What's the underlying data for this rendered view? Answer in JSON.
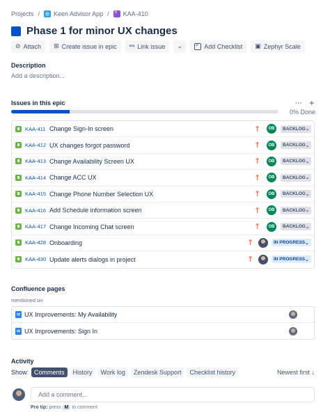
{
  "breadcrumb": {
    "projects": "Projects",
    "project": "Keen Advisor App",
    "issue_key": "KAA-410",
    "sep": "/"
  },
  "issue": {
    "title": "Phase 1 for minor UX changes"
  },
  "toolbar": {
    "attach": "Attach",
    "create_issue": "Create issue in epic",
    "link_issue": "Link issue",
    "add_checklist": "Add Checklist",
    "zephyr": "Zephyr Scale"
  },
  "description": {
    "heading": "Description",
    "placeholder": "Add a description..."
  },
  "epic": {
    "heading": "Issues in this epic",
    "progress_text": "0% Done",
    "progress_fraction": 0.22,
    "issues": [
      {
        "key": "KAA-411",
        "summary": "Change Sign-In screen",
        "assignee": "OB",
        "status": "BACKLOG"
      },
      {
        "key": "KAA-412",
        "summary": "UX changes forgot password",
        "assignee": "OB",
        "status": "BACKLOG"
      },
      {
        "key": "KAA-413",
        "summary": "Change Availability Screen UX",
        "assignee": "OB",
        "status": "BACKLOG"
      },
      {
        "key": "KAA-414",
        "summary": "Change ACC UX",
        "assignee": "OB",
        "status": "BACKLOG"
      },
      {
        "key": "KAA-415",
        "summary": "Change Phone Number Selection UX",
        "assignee": "OB",
        "status": "BACKLOG"
      },
      {
        "key": "KAA-416",
        "summary": "Add Schedule information screen",
        "assignee": "OB",
        "status": "BACKLOG"
      },
      {
        "key": "KAA-417",
        "summary": "Change Incoming Chat screen",
        "assignee": "OB",
        "status": "BACKLOG"
      },
      {
        "key": "KAA-428",
        "summary": "Onboarding",
        "assignee": "",
        "status": "IN PROGRESS"
      },
      {
        "key": "KAA-430",
        "summary": "Update alerts dialogs in project",
        "assignee": "",
        "status": "IN PROGRESS"
      }
    ]
  },
  "confluence": {
    "heading": "Confluence pages",
    "mentioned": "mentioned on",
    "pages": [
      "UX Improvements: My Availability",
      "UX Improvements: Sign In"
    ]
  },
  "activity": {
    "heading": "Activity",
    "show_label": "Show:",
    "tabs": [
      "Comments",
      "History",
      "Work log",
      "Zendesk Support",
      "Checklist history"
    ],
    "sort": "Newest first ↓",
    "comment_placeholder": "Add a comment...",
    "protip_label": "Pro tip:",
    "protip_press": "press",
    "protip_key": "M",
    "protip_rest": "to comment"
  },
  "colors": {
    "accent": "#0052cc",
    "story": "#63ba3c",
    "priority": "#ff7452",
    "assignee": "#00875a"
  }
}
